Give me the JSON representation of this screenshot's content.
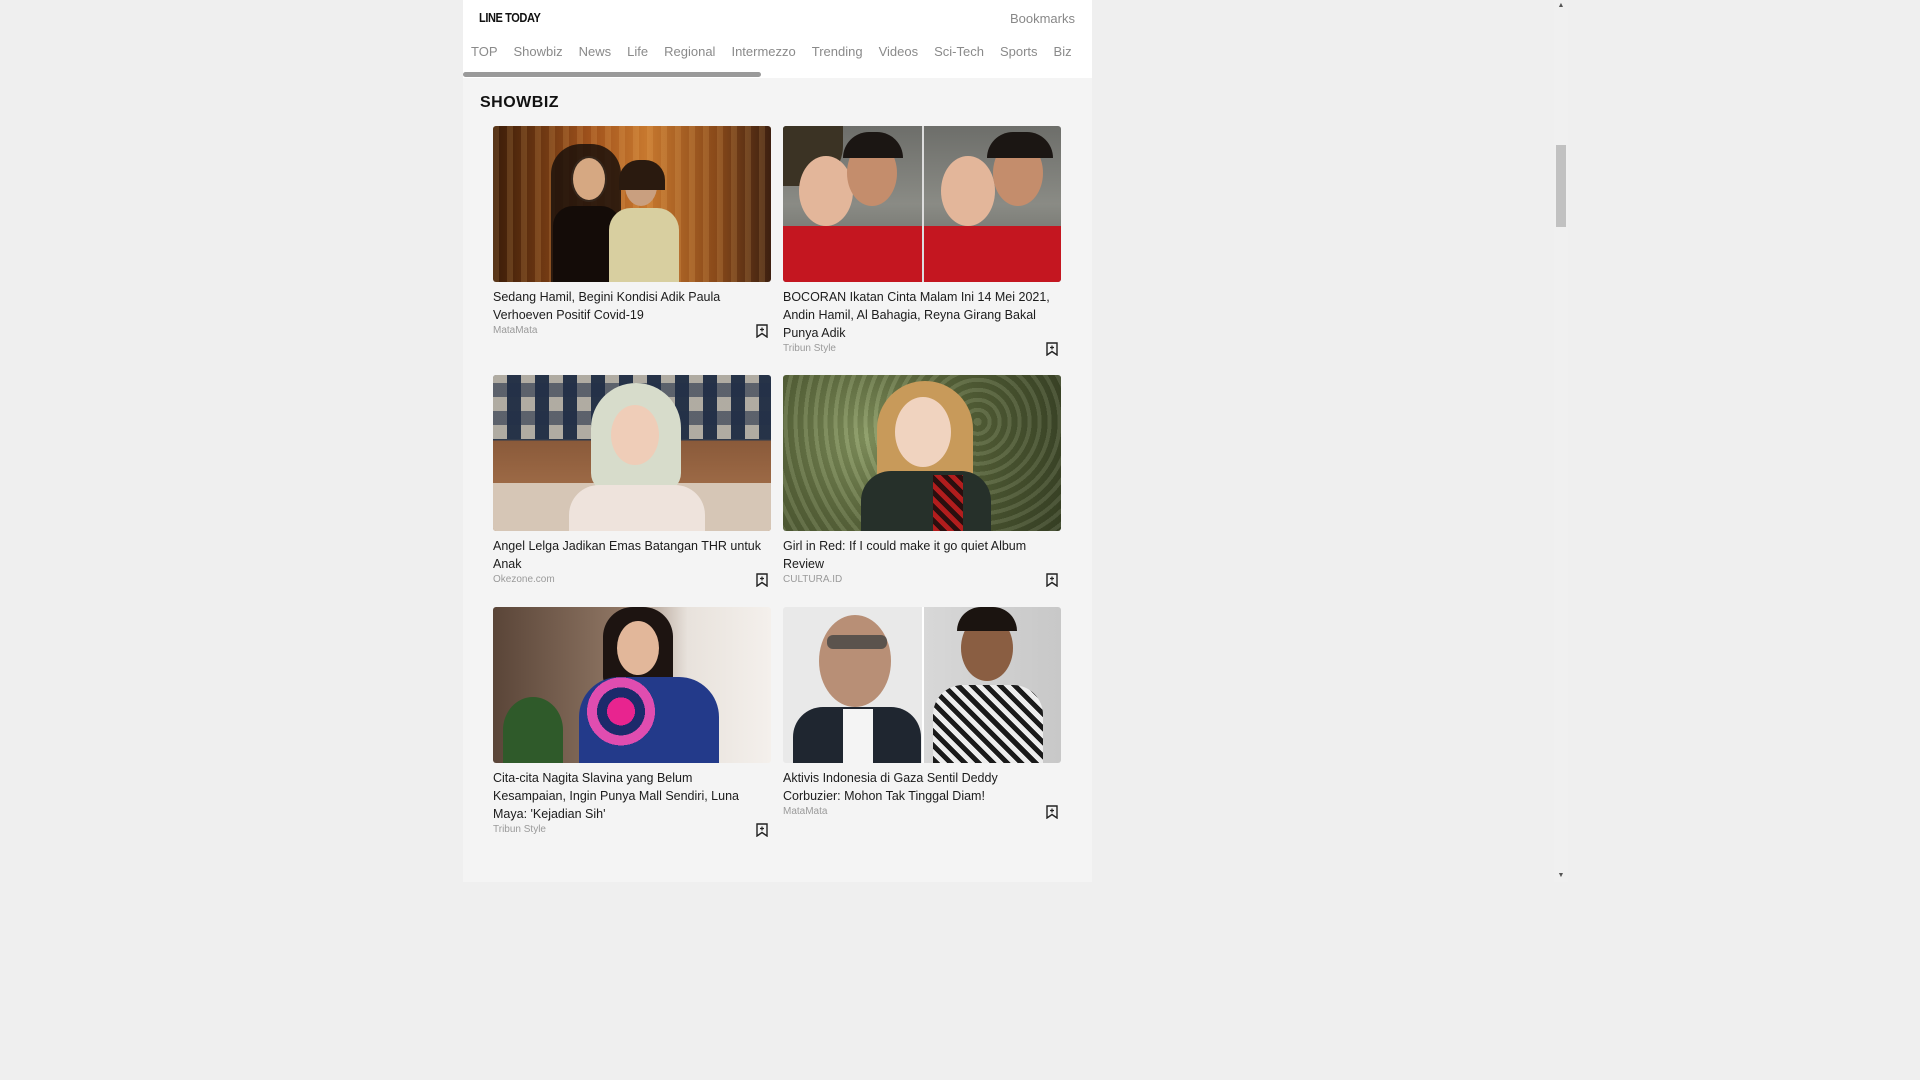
{
  "header": {
    "logo": "LINE TODAY",
    "bookmarks_label": "Bookmarks"
  },
  "tabs": [
    {
      "label": "TOP"
    },
    {
      "label": "Showbiz"
    },
    {
      "label": "News"
    },
    {
      "label": "Life"
    },
    {
      "label": "Regional"
    },
    {
      "label": "Intermezzo"
    },
    {
      "label": "Trending"
    },
    {
      "label": "Videos"
    },
    {
      "label": "Sci-Tech"
    },
    {
      "label": "Sports"
    },
    {
      "label": "Biz"
    }
  ],
  "section": {
    "title": "SHOWBIZ"
  },
  "articles": [
    {
      "headline": "Sedang Hamil, Begini Kondisi Adik Paula Verhoeven Positif Covid-19",
      "source": "MataMata"
    },
    {
      "headline": "BOCORAN Ikatan Cinta Malam Ini 14 Mei 2021, Andin Hamil, Al Bahagia, Reyna Girang Bakal Punya Adik",
      "source": "Tribun Style"
    },
    {
      "headline": "Angel Lelga Jadikan Emas Batangan THR untuk Anak",
      "source": "Okezone.com"
    },
    {
      "headline": "Girl in Red: If I could make it go quiet Album Review",
      "source": "CULTURA.ID"
    },
    {
      "headline": "Cita-cita Nagita Slavina yang Belum Kesampaian, Ingin Punya Mall Sendiri, Luna Maya: 'Kejadian Sih'",
      "source": "Tribun Style"
    },
    {
      "headline": "Aktivis Indonesia di Gaza Sentil Deddy Corbuzier: Mohon Tak Tinggal Diam!",
      "source": "MataMata"
    }
  ],
  "icons": {
    "bookmark": "bookmark-add-icon",
    "scroll_up": "scroll-up-arrow-icon",
    "scroll_down": "scroll-down-arrow-icon"
  }
}
